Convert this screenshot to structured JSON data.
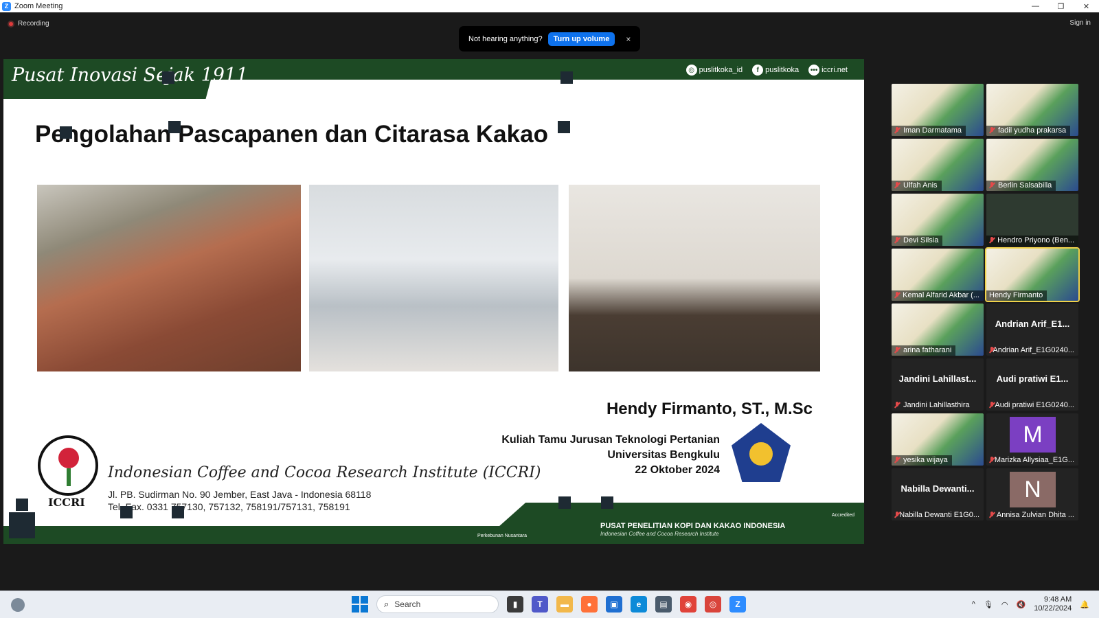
{
  "window": {
    "title": "Zoom Meeting",
    "minimize": "—",
    "restore": "❐",
    "close": "✕"
  },
  "recording": {
    "label": "Recording"
  },
  "signin": "Sign in",
  "toast": {
    "message": "Not hearing anything?",
    "button": "Turn up volume",
    "close": "×"
  },
  "slide": {
    "tagline": "Pusat Inovasi Sejak 1911",
    "social": [
      {
        "icon": "instagram-icon",
        "glyph": "◎",
        "text": "puslitkoka_id"
      },
      {
        "icon": "facebook-icon",
        "glyph": "f",
        "text": "puslitkoka"
      },
      {
        "icon": "web-icon",
        "glyph": "•••",
        "text": "iccri.net"
      }
    ],
    "heading": "Pengolahan Pascapanen dan Citarasa Kakao",
    "presenter": "Hendy Firmanto, ST., M.Sc",
    "lecture_line1": "Kuliah Tamu Jurusan Teknologi Pertanian",
    "lecture_line2": "Universitas Bengkulu",
    "lecture_date": "22 Oktober 2024",
    "institute": "Indonesian Coffee and Cocoa Research Institute  (ICCRI)",
    "address": "Jl. PB. Sudirman No. 90 Jember, East Java - Indonesia 68118",
    "phone": "Tel. Fax. 0331 757130, 757132, 758191/757131, 758191",
    "logo_text": "ICCRI",
    "footer_title": "PUSAT PENELITIAN KOPI DAN KAKAO INDONESIA",
    "footer_sub": "Indonesian Coffee and Cocoa Research Institute",
    "footer_left": "Perkebunan Nusantara",
    "footer_badge": "Accredited"
  },
  "participants": [
    {
      "name": "Iman Darmatama",
      "type": "video"
    },
    {
      "name": "fadil yudha prakarsa",
      "type": "video"
    },
    {
      "name": "Ulfah Anis",
      "type": "video"
    },
    {
      "name": "Berlin Salsabilla",
      "type": "video"
    },
    {
      "name": "Devi Silsia",
      "type": "video"
    },
    {
      "name": "Hendro Priyono (Ben...",
      "type": "video"
    },
    {
      "name": "Kemal Alfarid Akbar (...",
      "type": "video"
    },
    {
      "name": "Hendy Firmanto",
      "type": "video",
      "active": true
    },
    {
      "name": "arina fatharani",
      "type": "video"
    },
    {
      "name": "Andrian Arif_E1G0240...",
      "type": "text",
      "big": "Andrian Arif_E1..."
    },
    {
      "name": "Jandini Lahillasthira",
      "type": "text",
      "big": "Jandini Lahillast..."
    },
    {
      "name": "Audi pratiwi E1G0240...",
      "type": "text",
      "big": "Audi pratiwi E1..."
    },
    {
      "name": "yesika wijaya",
      "type": "video"
    },
    {
      "name": "Marizka Allysiaa_E1G...",
      "type": "avatar",
      "letter": "M",
      "color": "#7b3fc2"
    },
    {
      "name": "Nabilla Dewanti E1G0...",
      "type": "text",
      "big": "Nabilla Dewanti..."
    },
    {
      "name": "Annisa Zulvian Dhita ...",
      "type": "avatar",
      "letter": "N",
      "color": "#8a6a66"
    }
  ],
  "taskbar": {
    "search_placeholder": "Search",
    "time": "9:48 AM",
    "date": "10/22/2024",
    "apps": [
      {
        "icon": "file-explorer-window-icon",
        "color": "#3a3a3a",
        "glyph": "▮"
      },
      {
        "icon": "teams-icon",
        "color": "#5059c9",
        "glyph": "T"
      },
      {
        "icon": "folder-icon",
        "color": "#f2b84b",
        "glyph": "▬"
      },
      {
        "icon": "firefox-icon",
        "color": "#ff7139",
        "glyph": "●"
      },
      {
        "icon": "store-icon",
        "color": "#1f6fd1",
        "glyph": "▣"
      },
      {
        "icon": "edge-icon",
        "color": "#0d8ad8",
        "glyph": "e"
      },
      {
        "icon": "remote-desktop-icon",
        "color": "#4a5b6c",
        "glyph": "▤"
      },
      {
        "icon": "chrome-icon",
        "color": "#e0433a",
        "glyph": "◉"
      },
      {
        "icon": "chrome-alt-icon",
        "color": "#d9443b",
        "glyph": "◎"
      },
      {
        "icon": "zoom-icon",
        "color": "#2d8cff",
        "glyph": "Z"
      }
    ],
    "tray": {
      "chevron": "^",
      "mic": "🎙",
      "wifi": "◠",
      "speaker": "🔇",
      "bell": "🔔"
    }
  }
}
